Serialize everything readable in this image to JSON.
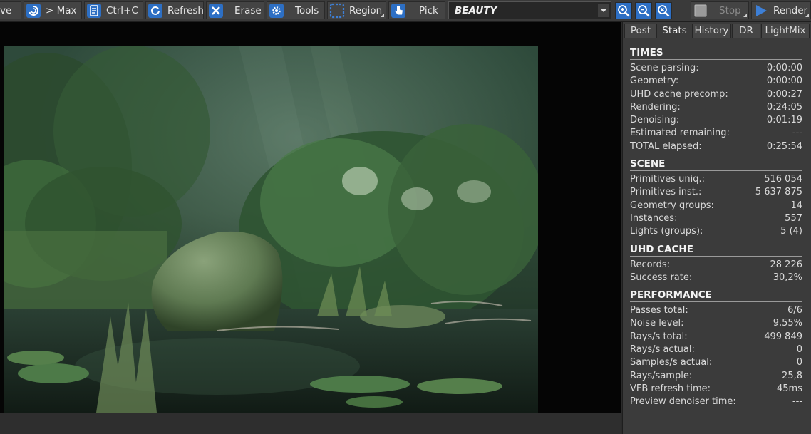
{
  "toolbar": {
    "save_partial": "ve",
    "max_label": "> Max",
    "copy_label": "Ctrl+C",
    "refresh_label": "Refresh",
    "erase_label": "Erase",
    "tools_label": "Tools",
    "region_label": "Region",
    "pick_label": "Pick",
    "channel_value": "BEAUTY",
    "stop_label": "Stop",
    "render_label": "Render"
  },
  "tabs": [
    "Post",
    "Stats",
    "History",
    "DR",
    "LightMix"
  ],
  "active_tab": "Stats",
  "stats": {
    "times": {
      "title": "TIMES",
      "rows": [
        {
          "label": "Scene parsing:",
          "value": "0:00:00"
        },
        {
          "label": "Geometry:",
          "value": "0:00:00"
        },
        {
          "label": "UHD cache precomp:",
          "value": "0:00:27"
        },
        {
          "label": "Rendering:",
          "value": "0:24:05"
        },
        {
          "label": "Denoising:",
          "value": "0:01:19"
        },
        {
          "label": "Estimated remaining:",
          "value": "---"
        },
        {
          "label": "TOTAL elapsed:",
          "value": "0:25:54"
        }
      ]
    },
    "scene": {
      "title": "SCENE",
      "rows": [
        {
          "label": "Primitives uniq.:",
          "value": "516 054"
        },
        {
          "label": "Primitives inst.:",
          "value": "5 637 875"
        },
        {
          "label": "Geometry groups:",
          "value": "14"
        },
        {
          "label": "Instances:",
          "value": "557"
        },
        {
          "label": "Lights (groups):",
          "value": "5 (4)"
        }
      ]
    },
    "uhd": {
      "title": "UHD CACHE",
      "rows": [
        {
          "label": "Records:",
          "value": "28 226"
        },
        {
          "label": "Success rate:",
          "value": "30,2%"
        }
      ]
    },
    "perf": {
      "title": "PERFORMANCE",
      "rows": [
        {
          "label": "Passes total:",
          "value": "6/6"
        },
        {
          "label": "Noise level:",
          "value": "9,55%"
        },
        {
          "label": "Rays/s total:",
          "value": "499 849"
        },
        {
          "label": "Rays/s actual:",
          "value": "0"
        },
        {
          "label": "Samples/s actual:",
          "value": "0"
        },
        {
          "label": "Rays/sample:",
          "value": "25,8"
        },
        {
          "label": "VFB refresh time:",
          "value": "45ms"
        },
        {
          "label": "Preview denoiser time:",
          "value": "---"
        }
      ]
    }
  },
  "icons": {
    "max": "swirl-icon",
    "copy": "clipboard-icon",
    "refresh": "refresh-icon",
    "erase": "erase-x-icon",
    "tools": "gear-icon",
    "region": "region-select-icon",
    "pick": "hand-pointer-icon",
    "zoom_in": "zoom-in-icon",
    "zoom_out": "zoom-out-icon",
    "zoom_fit": "zoom-fit-icon",
    "stop": "stop-icon",
    "render": "play-icon"
  },
  "colors": {
    "accent": "#3d7fd6",
    "panel_bg": "#3b3b3b",
    "toolbar_bg": "#3a3a3a",
    "active_tab_border": "#6c8fb8"
  }
}
